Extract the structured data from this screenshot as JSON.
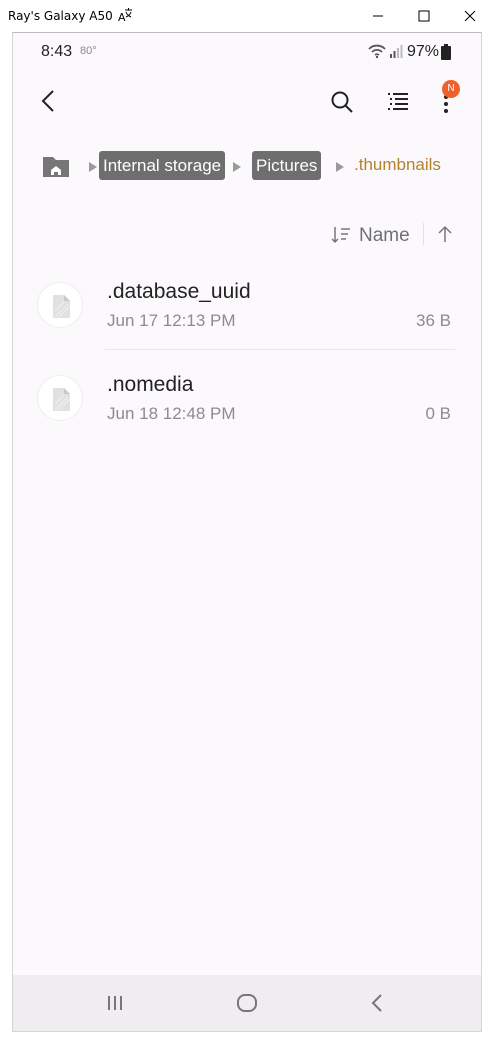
{
  "window": {
    "title": "Ray's Galaxy A50",
    "translate_icon": "translate-icon",
    "minimize_icon": "minimize-icon",
    "maximize_icon": "maximize-icon",
    "close_icon": "close-icon"
  },
  "status_bar": {
    "time": "8:43",
    "temperature": "80°",
    "battery": "97%",
    "wifi_icon": "wifi-icon",
    "signal_icon": "signal-icon",
    "battery_icon": "battery-icon"
  },
  "top_bar": {
    "back_icon": "back-chevron-icon",
    "search_icon": "search-icon",
    "list_view_icon": "list-view-icon",
    "more_icon": "more-vertical-icon",
    "badge": "N",
    "badge_color": "#f1602a"
  },
  "breadcrumb": {
    "home_icon": "home-folder-icon",
    "items": [
      "Internal storage",
      "Pictures"
    ],
    "current": ".thumbnails",
    "current_color": "#b3822c"
  },
  "sort": {
    "icon": "sort-icon",
    "label": "Name",
    "direction_icon": "arrow-up-icon"
  },
  "files": [
    {
      "name": ".database_uuid",
      "date": "Jun 17 12:13 PM",
      "size": "36 B",
      "icon": "file-icon"
    },
    {
      "name": ".nomedia",
      "date": "Jun 18 12:48 PM",
      "size": "0 B",
      "icon": "file-icon"
    }
  ],
  "nav_bar": {
    "recent_icon": "recent-apps-icon",
    "home_icon": "home-button-icon",
    "back_icon": "back-button-icon"
  }
}
